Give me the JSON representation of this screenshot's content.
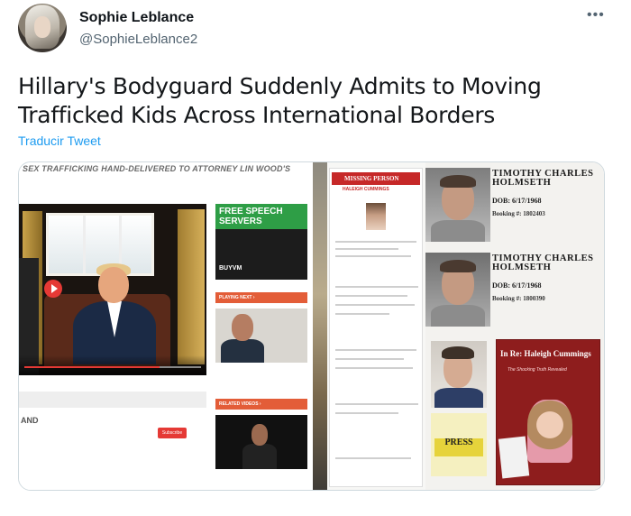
{
  "header": {
    "name": "Sophie Leblance",
    "handle": "@SophieLeblance2",
    "more": "•••"
  },
  "tweet": {
    "text": "Hillary's Bodyguard Suddenly Admits to Moving Trafficked Kids Across International Borders",
    "translate": "Traducir Tweet"
  },
  "media": {
    "banner": "SEX TRAFFICKING HAND-DELIVERED TO ATTORNEY LIN WOOD'S",
    "ad_title": "FREE SPEECH SERVERS",
    "ad_logo": "BUYVM",
    "playing_next": "PLAYING NEXT ›",
    "related": "RELATED VIDEOS ›",
    "section": "AND",
    "subscribe": "Subscribe",
    "missing_person": "MISSING PERSON",
    "missing_name": "HALEIGH CUMMINGS",
    "mug1_name": "TIMOTHY CHARLES HOLMSETH",
    "mug1_dob": "DOB: 6/17/1968",
    "mug1_booking": "Booking #: 1802403",
    "mug2_name": "TIMOTHY CHARLES HOLMSETH",
    "mug2_dob": "DOB: 6/17/1968",
    "mug2_booking": "Booking #: 1800390",
    "press": "PRESS",
    "book_title": "In Re: Haleigh Cummings",
    "book_sub": "The Shocking Truth Revealed"
  }
}
